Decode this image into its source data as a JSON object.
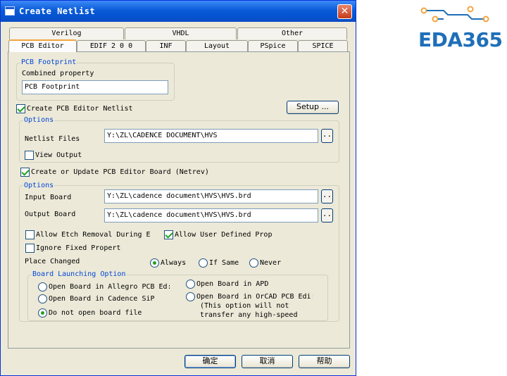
{
  "window": {
    "title": "Create Netlist",
    "close_glyph": "✕"
  },
  "tabs_row1": [
    "Verilog",
    "VHDL",
    "Other"
  ],
  "tabs_row2": [
    "PCB Editor",
    "EDIF 2 0 0",
    "INF",
    "Layout",
    "PSpice",
    "SPICE"
  ],
  "active_tab": "PCB Editor",
  "footprint": {
    "legend": "PCB Footprint",
    "label": "Combined property",
    "value": "PCB Footprint"
  },
  "create_netlist": {
    "label": "Create PCB Editor Netlist",
    "checked": true
  },
  "setup_button": "Setup ...",
  "options1": {
    "legend": "Options",
    "netlist_label": "Netlist Files",
    "netlist_value": "Y:\\ZL\\CADENCE DOCUMENT\\HVS",
    "browse": "..",
    "view_output_label": "View Output",
    "view_output_checked": false
  },
  "update_board": {
    "label": "Create or Update PCB Editor Board (Netrev)",
    "checked": true
  },
  "options2": {
    "legend": "Options",
    "input_label": "Input Board",
    "input_value": "Y:\\ZL\\cadence document\\HVS\\HVS.brd",
    "output_label": "Output Board",
    "output_value": "Y:\\ZL\\cadence document\\HVS\\HVS.brd",
    "browse": "..",
    "allow_etch_label": "Allow Etch Removal During E",
    "allow_etch_checked": false,
    "allow_user_label": "Allow User Defined Prop",
    "allow_user_checked": true,
    "ignore_fixed_label": "Ignore Fixed Propert",
    "ignore_fixed_checked": false,
    "place_changed_label": "Place Changed",
    "place_always": "Always",
    "place_if_same": "If Same",
    "place_never": "Never",
    "place_selected": "Always"
  },
  "launching": {
    "legend": "Board Launching Option",
    "open_allegro": "Open Board in Allegro PCB Ed:",
    "open_sip": "Open Board in Cadence SiP",
    "do_not_open": "Do not open board file",
    "open_apd": "Open Board in APD",
    "open_orcad": "Open Board in OrCAD PCB Edi:",
    "note_line1": "(This option will not",
    "note_line2": "transfer any high-speed",
    "selected": "Do not open board file"
  },
  "buttons": {
    "ok": "确定",
    "cancel": "取消",
    "help": "帮助"
  },
  "logo": {
    "text": "EDA365",
    "color": "#1f6fb8",
    "accent": "#f2a43c"
  }
}
